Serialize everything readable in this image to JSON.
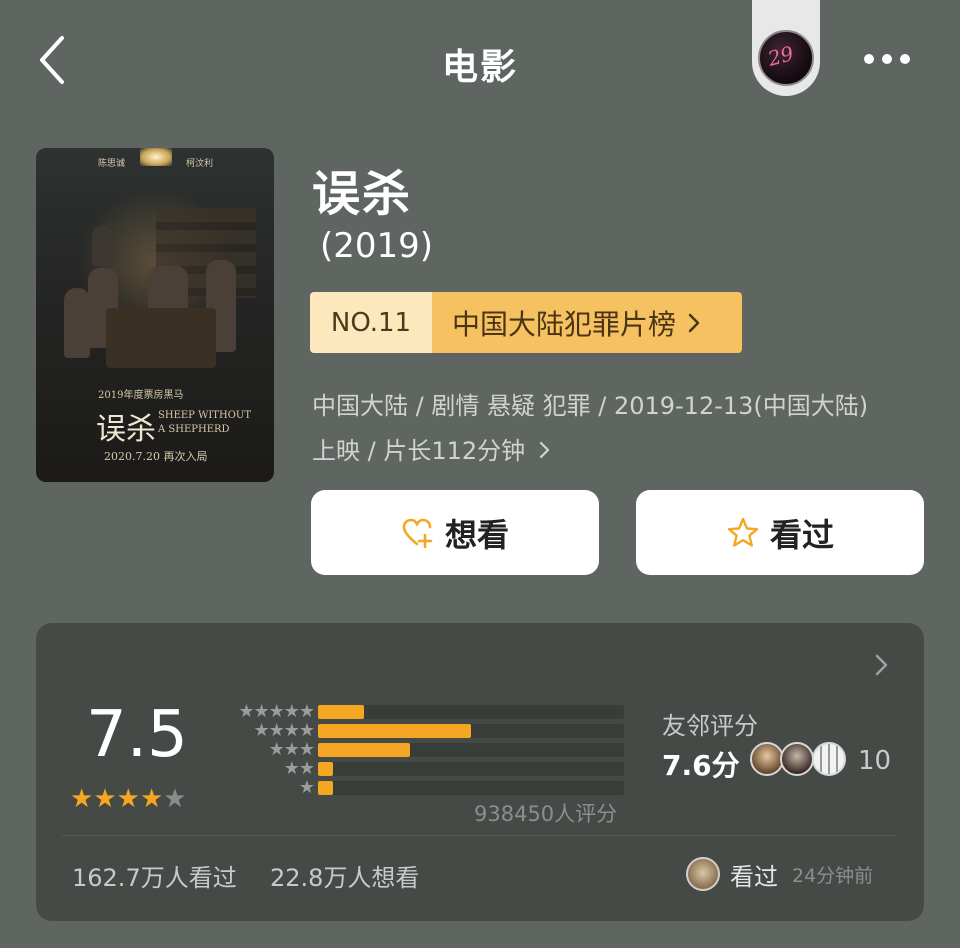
{
  "header": {
    "title": "电影",
    "back_icon": "chevron-left-icon",
    "more_icon": "more-horizontal-icon",
    "avatar_text": "29"
  },
  "poster": {
    "tagline": "2019年度票房黑马",
    "actor_left": "陈思诚",
    "actor_right": "柯汶利",
    "title_cn": "误杀",
    "title_en_line1": "SHEEP WITHOUT",
    "title_en_line2": "A SHEPHERD",
    "date_line": "2020.7.20 再次入局"
  },
  "movie": {
    "title": "误杀",
    "year": "(2019)",
    "rank_no": "NO.11",
    "rank_list": "中国大陆犯罪片榜",
    "meta_line1": "中国大陆 / 剧情 悬疑 犯罪 / 2019-12-13(中国大陆)",
    "meta_line2": "上映 / 片长112分钟"
  },
  "actions": {
    "want_label": "想看",
    "watched_label": "看过"
  },
  "rating": {
    "score": "7.5",
    "stars_filled": 4,
    "stars_total": 5,
    "distribution": [
      {
        "stars": "★★★★★",
        "fraction": 0.15
      },
      {
        "stars": "★★★★",
        "fraction": 0.5
      },
      {
        "stars": "★★★",
        "fraction": 0.3
      },
      {
        "stars": "★★",
        "fraction": 0.05
      },
      {
        "stars": "★",
        "fraction": 0.05
      }
    ],
    "count_text": "938450人评分",
    "friend_label": "友邻评分",
    "friend_score": "7.6分",
    "friend_count": "10",
    "watched_count": "162.7万人看过",
    "want_count": "22.8万人想看",
    "activity_text": "看过",
    "activity_time": "24分钟前"
  },
  "colors": {
    "accent": "#f5a623",
    "background": "#5f6561",
    "card": "#454a47"
  }
}
